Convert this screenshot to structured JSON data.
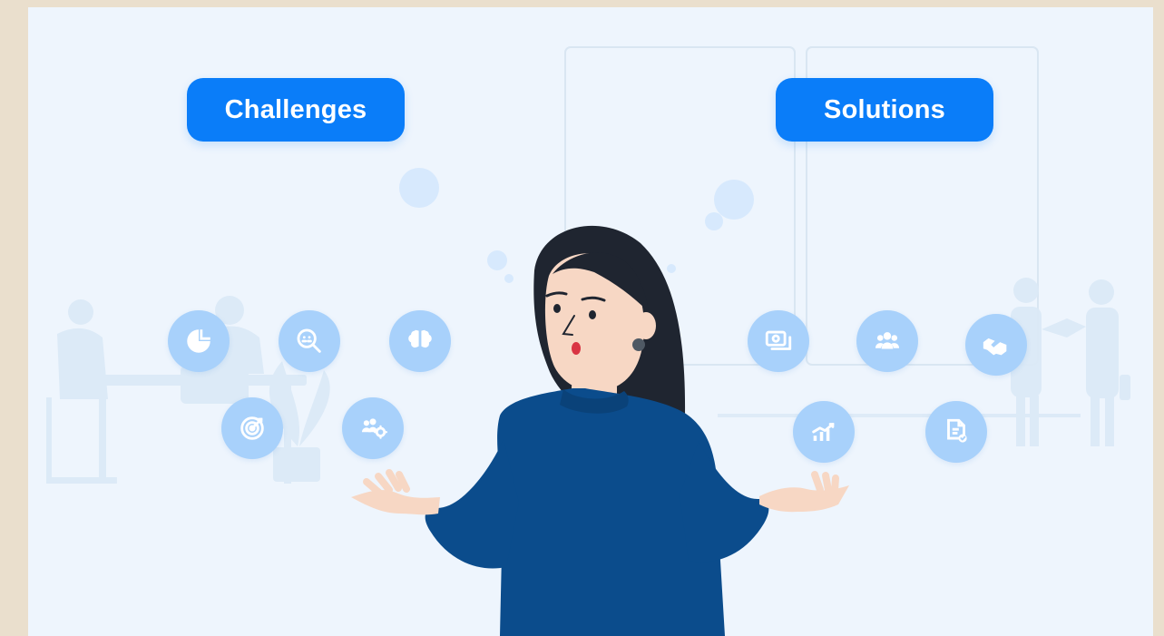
{
  "labels": {
    "challenges": "Challenges",
    "solutions": "Solutions"
  },
  "icons": {
    "challenges": [
      "pie-chart-icon",
      "search-people-icon",
      "brain-icon",
      "target-icon",
      "team-gear-icon"
    ],
    "solutions": [
      "money-icon",
      "group-icon",
      "handshake-icon",
      "growth-chart-icon",
      "document-check-icon"
    ]
  },
  "colors": {
    "page_border": "#eadfcd",
    "background": "#eef5fd",
    "button": "#0a7df9",
    "icon_bubble": "#a8d1fb",
    "sweater": "#0b4c8c",
    "hair": "#1f2530",
    "skin": "#f7d7c4"
  }
}
